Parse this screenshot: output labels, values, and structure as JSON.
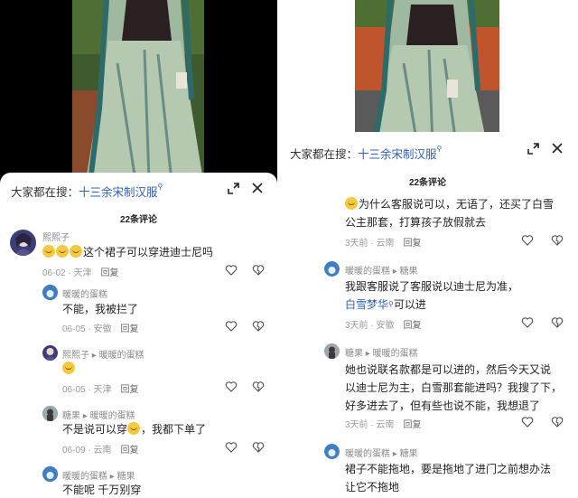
{
  "left": {
    "search_prefix": "大家都在搜：",
    "search_term": "十三余宋制汉服",
    "comment_count": "22条评论",
    "comments": [
      {
        "user": "熙熙子",
        "text": "这个裙子可以穿进迪士尼吗",
        "date": "06-02",
        "location": "天津",
        "reply": "回复"
      },
      {
        "user": "暖暖的蛋糕",
        "text": "不能，我被拦了",
        "date": "06-05",
        "location": "安徽",
        "reply": "回复"
      },
      {
        "user": "熙熙子",
        "reply_to": "暖暖的蛋糕",
        "text": "",
        "date": "06-05",
        "location": "天津",
        "reply": "回复"
      },
      {
        "user": "糖果",
        "reply_to": "暖暖的蛋糕",
        "text_a": "不是说可以穿",
        "text_b": "，我都下单了",
        "date": "06-09",
        "location": "云南",
        "reply": "回复"
      },
      {
        "user": "暖暖的蛋糕",
        "reply_to": "糖果",
        "text": "不能呢 千万别穿"
      }
    ]
  },
  "right": {
    "search_prefix": "大家都在搜：",
    "search_term": "十三余宋制汉服",
    "comment_count": "22条评论",
    "comments": [
      {
        "line1": "为什么客服说可以，无语了，还买了白雪",
        "line2": "公主那套，打算孩子放假就去",
        "date": "3天前",
        "location": "云南",
        "reply": "回复"
      },
      {
        "user": "暖暖的蛋糕",
        "reply_to": "糖果",
        "line1": "我跟客服说了客服说以迪士尼为准，",
        "link": "白雪梦华",
        "line2_rest": "可以进",
        "date": "3天前",
        "location": "安徽",
        "reply": "回复"
      },
      {
        "user": "糖果",
        "reply_to": "暖暖的蛋糕",
        "line1": "她也说联名款都是可以进的，然后今天又说",
        "line2": "以迪士尼为主，白雪那套能进吗？我搜了下，",
        "line3": "好多进去了，但有些也说不能，我想退了",
        "date": "3天前",
        "location": "云南",
        "reply": "回复"
      },
      {
        "user": "暖暖的蛋糕",
        "reply_to": "糖果",
        "line1": "裙子不能拖地，要是拖地了进门之前想办法",
        "line2": "让它不拖地"
      }
    ]
  },
  "icons": {
    "expand": "expand-icon",
    "close": "close-icon",
    "like": "heart-icon",
    "dislike": "broken-heart-icon",
    "arrow": "arrow-right-icon"
  }
}
